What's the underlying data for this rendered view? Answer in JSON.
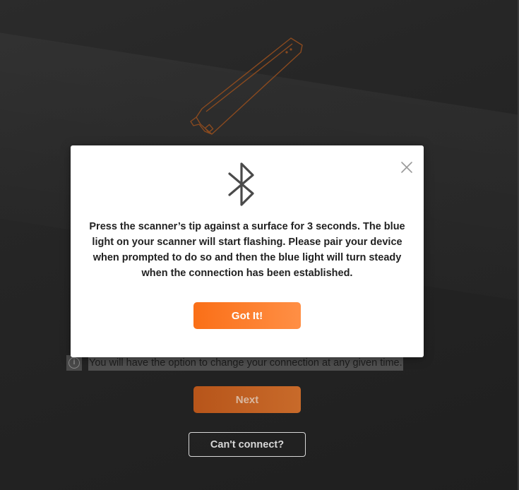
{
  "background": {
    "illustration": "scanner-pen-icon",
    "info_icon": "info-icon",
    "info_text": "You will have the option to change your connection at any given time.",
    "next_label": "Next",
    "cant_connect_label": "Can't connect?"
  },
  "modal": {
    "icon": "bluetooth-icon",
    "close_icon": "close-icon",
    "message": "Press the scanner’s tip against a surface for 3 seconds. The blue light on your scanner will start flashing. Please pair your device when prompted to do so and then the blue light will turn steady when the connection has been established.",
    "confirm_label": "Got It!"
  },
  "colors": {
    "accent": "#fa6f17",
    "accent_light": "#ff8f45",
    "background": "#242424",
    "modal_bg": "#ffffff",
    "text_dark": "#222222"
  }
}
